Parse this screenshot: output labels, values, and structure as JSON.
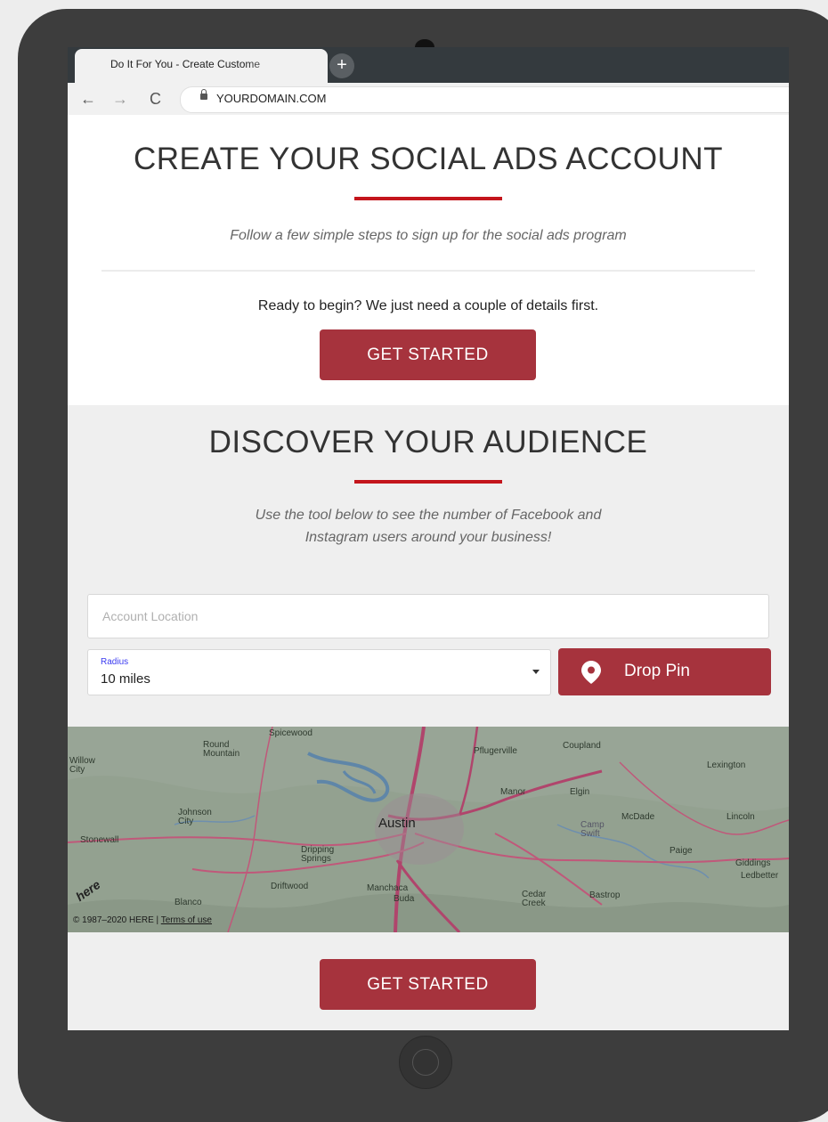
{
  "browser": {
    "tab_title": "Do It For You - Create Custome",
    "new_tab_label": "+",
    "url": "YOURDOMAIN.COM"
  },
  "signup": {
    "title": "CREATE YOUR SOCIAL ADS ACCOUNT",
    "subtitle": "Follow a few simple steps to sign up for the social ads program",
    "prompt": "Ready to begin? We just need a couple of details first.",
    "button_label": "GET STARTED"
  },
  "audience": {
    "title": "DISCOVER YOUR AUDIENCE",
    "subtitle_line1": "Use the tool below to see the number of Facebook and",
    "subtitle_line2": "Instagram users around your business!",
    "location_placeholder": "Account Location",
    "radius_label": "Radius",
    "radius_value": "10 miles",
    "drop_pin_label": "Drop Pin",
    "bottom_button_label": "GET STARTED"
  },
  "map": {
    "place_labels": [
      "Spicewood",
      "Round Mountain",
      "Willow City",
      "Pflugerville",
      "Coupland",
      "Lexington",
      "Manor",
      "Elgin",
      "Johnson City",
      "Austin",
      "McDade",
      "Lincoln",
      "Camp Swift",
      "Stonewall",
      "Dripping Springs",
      "Paige",
      "Giddings",
      "Ledbetter",
      "Driftwood",
      "Manchaca",
      "Buda",
      "Blanco",
      "Cedar Creek",
      "Bastrop"
    ],
    "logo_text": "here",
    "copyright": "© 1987–2020 HERE |",
    "terms_label": "Terms of use"
  },
  "colors": {
    "accent": "#a6333d",
    "divider_red": "#c4151c",
    "device_frame": "#3d3d3d"
  }
}
